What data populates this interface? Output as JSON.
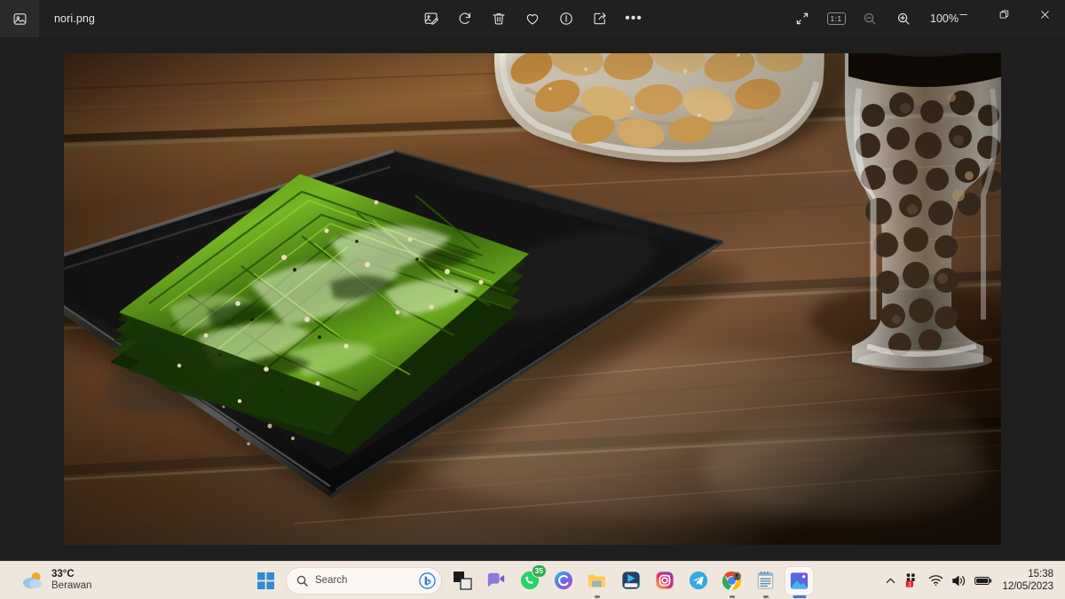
{
  "window": {
    "app_icon": "photos-app-icon",
    "file_title": "nori.png",
    "toolbar": {
      "edit_label": "Edit image",
      "rotate_label": "Rotate",
      "delete_label": "Delete",
      "favorite_label": "Add to favorites",
      "info_label": "File info",
      "share_label": "Share",
      "more_label": "See more",
      "more_glyph": "•••"
    },
    "view_tools": {
      "fullscreen_label": "Full screen",
      "actual_size_label": "1:1",
      "zoom_out_label": "Zoom out",
      "zoom_in_label": "Zoom in",
      "zoom_level": "100%"
    },
    "controls": {
      "minimize_label": "Minimize",
      "maximize_label": "Restore Down",
      "close_label": "Close"
    }
  },
  "photo": {
    "alt": "Roasted seaweed nori sheets on a black rectangular plate beside a bowl of roasted peanuts and a glass pepper grinder on a dark wooden table",
    "colors": {
      "wood_dark": "#3b2414",
      "wood_mid": "#6b3d1d",
      "wood_light": "#8a5a2b",
      "plate": "#141414",
      "nori_bright": "#67a81a",
      "nori_dark": "#1f3d08",
      "bowl": "#ece3d2",
      "peanut": "#e8b45c",
      "pepper": "#3a2a1c"
    }
  },
  "taskbar": {
    "weather": {
      "temperature": "33°C",
      "condition": "Berawan",
      "icon": "sun-behind-cloud-icon"
    },
    "start_label": "Start",
    "search": {
      "placeholder": "Search",
      "icon": "search-icon",
      "bing_icon": "bing-chat-icon"
    },
    "apps": [
      {
        "name": "widgets-app",
        "label": "Widgets",
        "running": false,
        "badge": ""
      },
      {
        "name": "chat-teams-app",
        "label": "Chat",
        "running": false,
        "badge": ""
      },
      {
        "name": "whatsapp-app",
        "label": "WhatsApp",
        "running": false,
        "badge": "35"
      },
      {
        "name": "copilot-app",
        "label": "Copilot",
        "running": false,
        "badge": ""
      },
      {
        "name": "file-explorer-app",
        "label": "File Explorer",
        "running": true,
        "badge": ""
      },
      {
        "name": "movies-app",
        "label": "Movies & TV",
        "running": false,
        "badge": ""
      },
      {
        "name": "instagram-app",
        "label": "Instagram",
        "running": false,
        "badge": ""
      },
      {
        "name": "telegram-app",
        "label": "Telegram",
        "running": false,
        "badge": ""
      },
      {
        "name": "chrome-app",
        "label": "Google Chrome",
        "running": true,
        "badge": ""
      },
      {
        "name": "notepad-app",
        "label": "Notepad",
        "running": true,
        "badge": ""
      },
      {
        "name": "photos-app",
        "label": "Photos",
        "running": true,
        "badge": "",
        "active": true
      }
    ],
    "tray": {
      "chevron_label": "Show hidden icons",
      "notification_badge": "3",
      "wifi_label": "Network",
      "volume_label": "Volume",
      "battery_label": "Battery",
      "time": "15:38",
      "date": "12/05/2023"
    }
  }
}
